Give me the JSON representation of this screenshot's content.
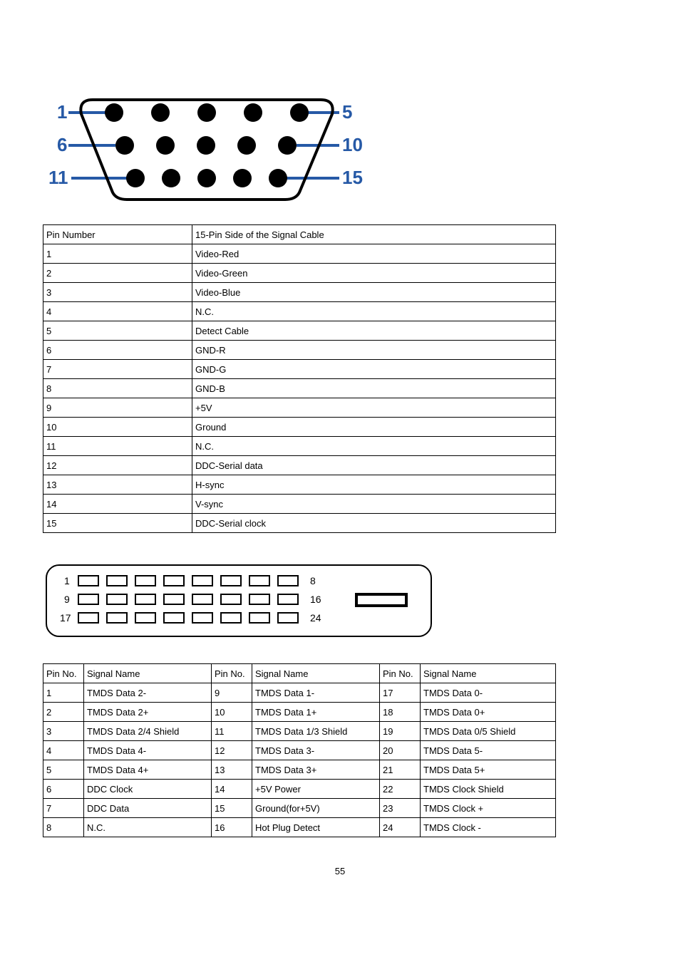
{
  "page_number": "55",
  "vga_diagram_labels": {
    "l1": "1",
    "l5": "5",
    "l6": "6",
    "l10": "10",
    "l11": "11",
    "l15": "15"
  },
  "dvi_diagram_labels": {
    "l1": "1",
    "l8": "8",
    "l9": "9",
    "l16": "16",
    "l17": "17",
    "l24": "24"
  },
  "table1": {
    "header": {
      "c1": "Pin Number",
      "c2": "15-Pin Side of the Signal Cable"
    },
    "rows": [
      {
        "c1": "1",
        "c2": "Video-Red"
      },
      {
        "c1": "2",
        "c2": "Video-Green"
      },
      {
        "c1": "3",
        "c2": "Video-Blue"
      },
      {
        "c1": "4",
        "c2": "N.C."
      },
      {
        "c1": "5",
        "c2": "Detect Cable"
      },
      {
        "c1": "6",
        "c2": "GND-R"
      },
      {
        "c1": "7",
        "c2": "GND-G"
      },
      {
        "c1": "8",
        "c2": "GND-B"
      },
      {
        "c1": "9",
        "c2": "+5V"
      },
      {
        "c1": "10",
        "c2": "Ground"
      },
      {
        "c1": "11",
        "c2": "N.C."
      },
      {
        "c1": "12",
        "c2": "DDC-Serial data"
      },
      {
        "c1": "13",
        "c2": "H-sync"
      },
      {
        "c1": "14",
        "c2": "V-sync"
      },
      {
        "c1": "15",
        "c2": "DDC-Serial clock"
      }
    ]
  },
  "table2": {
    "header": {
      "c1": "Pin No.",
      "c2": "Signal Name",
      "c3": "Pin No.",
      "c4": "Signal Name",
      "c5": "Pin No.",
      "c6": "Signal Name"
    },
    "rows": [
      {
        "c1": "1",
        "c2": "TMDS Data 2-",
        "c3": "9",
        "c4": "TMDS Data 1-",
        "c5": "17",
        "c6": "TMDS Data 0-"
      },
      {
        "c1": "2",
        "c2": "TMDS Data 2+",
        "c3": "10",
        "c4": "TMDS Data 1+",
        "c5": "18",
        "c6": "TMDS Data 0+"
      },
      {
        "c1": "3",
        "c2": "TMDS Data 2/4 Shield",
        "c3": "11",
        "c4": "TMDS Data 1/3 Shield",
        "c5": "19",
        "c6": "TMDS Data 0/5 Shield"
      },
      {
        "c1": "4",
        "c2": "TMDS Data 4-",
        "c3": "12",
        "c4": "TMDS Data 3-",
        "c5": "20",
        "c6": "TMDS Data 5-"
      },
      {
        "c1": "5",
        "c2": "TMDS Data 4+",
        "c3": "13",
        "c4": "TMDS Data 3+",
        "c5": "21",
        "c6": "TMDS Data 5+"
      },
      {
        "c1": "6",
        "c2": "DDC Clock",
        "c3": "14",
        "c4": "+5V Power",
        "c5": "22",
        "c6": "TMDS Clock Shield"
      },
      {
        "c1": "7",
        "c2": "DDC Data",
        "c3": "15",
        "c4": "Ground(for+5V)",
        "c5": "23",
        "c6": "TMDS Clock +"
      },
      {
        "c1": "8",
        "c2": "N.C.",
        "c3": "16",
        "c4": "Hot Plug Detect",
        "c5": "24",
        "c6": "TMDS Clock -"
      }
    ]
  }
}
